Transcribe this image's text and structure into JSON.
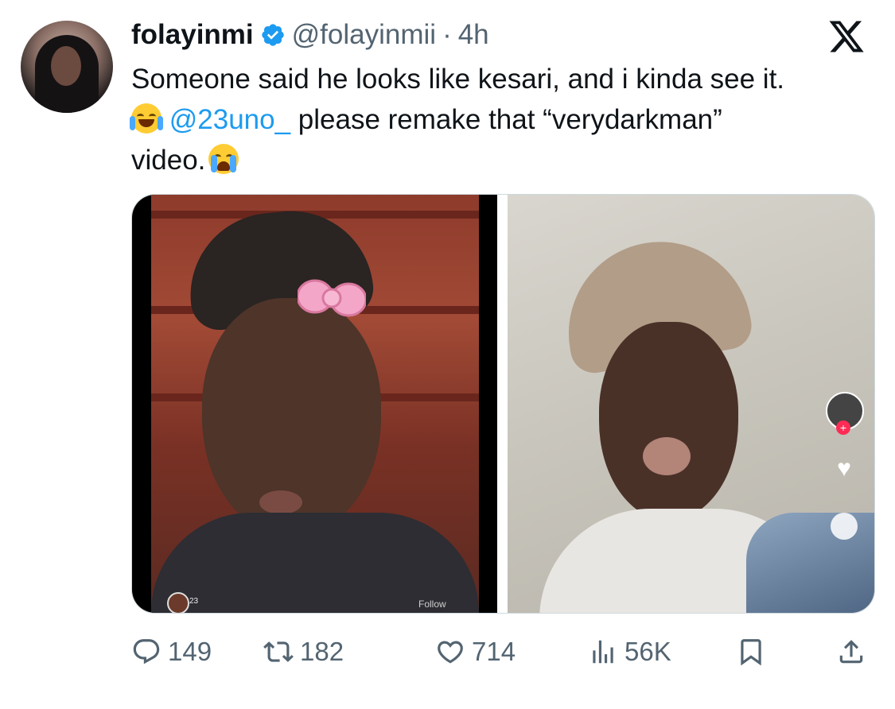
{
  "author": {
    "display_name": "folayinmi",
    "handle": "@folayinmii",
    "separator": "·",
    "time": "4h",
    "verified": true
  },
  "tweet": {
    "line1": "Someone said he looks like kesari, and i kinda see it.",
    "line2_emoji": "laughing-with-tears-emoji",
    "mention": "@23uno_",
    "line2_rest": " please remake that “verydarkman”",
    "line3": "video.",
    "line3_emoji": "loudly-crying-emoji"
  },
  "media": {
    "left_photo": {
      "overlay_label": "Follow",
      "badge_count": "23"
    },
    "right_photo": {
      "ui": "tiktok-sidebar"
    }
  },
  "actions": {
    "replies": "149",
    "retweets": "182",
    "likes": "714",
    "views": "56K"
  },
  "colors": {
    "text": "#0f1419",
    "muted": "#536471",
    "link": "#1d9bf0",
    "verified": "#1d9bf0"
  }
}
